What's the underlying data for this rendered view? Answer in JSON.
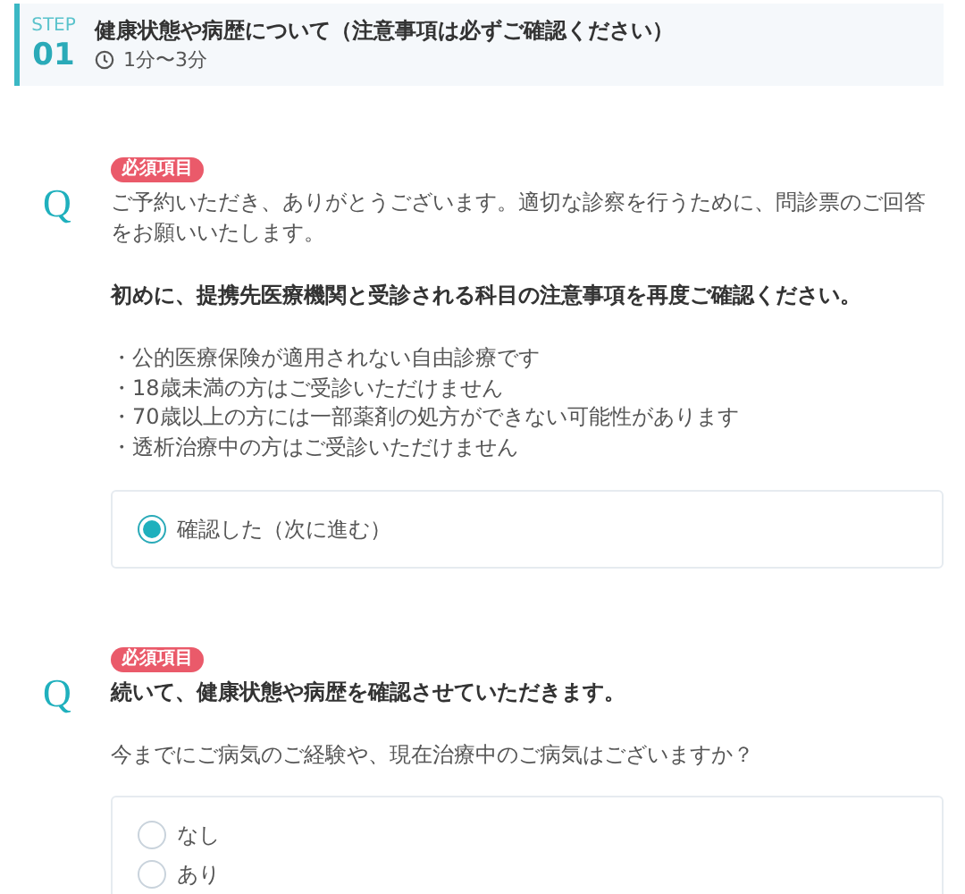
{
  "step": {
    "label": "STEP",
    "number": "01",
    "title": "健康状態や病歴について（注意事項は必ずご確認ください）",
    "duration": "1分〜3分"
  },
  "questions": [
    {
      "mark": "Q",
      "badge": "必須項目",
      "blocks": [
        {
          "kind": "text",
          "text": "ご予約いただき、ありがとうございます。適切な診察を行うために、問診票のご回答をお願いいたします。"
        },
        {
          "kind": "bold",
          "text": "初めに、提携先医療機関と受診される科目の注意事項を再度ご確認ください。"
        },
        {
          "kind": "bullets",
          "items": [
            "・公的医療保険が適用されない自由診療です",
            "・18歳未満の方はご受診いただけません",
            "・70歳以上の方には一部薬剤の処方ができない可能性があります",
            "・透析治療中の方はご受診いただけません"
          ]
        }
      ],
      "options": [
        {
          "label": "確認した（次に進む）",
          "selected": true
        }
      ]
    },
    {
      "mark": "Q",
      "badge": "必須項目",
      "blocks": [
        {
          "kind": "bold",
          "text": "続いて、健康状態や病歴を確認させていただきます。"
        },
        {
          "kind": "text",
          "text": "今までにご病気のご経験や、現在治療中のご病気はございますか？"
        }
      ],
      "options": [
        {
          "label": "なし",
          "selected": false
        },
        {
          "label": "あり",
          "selected": false
        }
      ]
    }
  ]
}
